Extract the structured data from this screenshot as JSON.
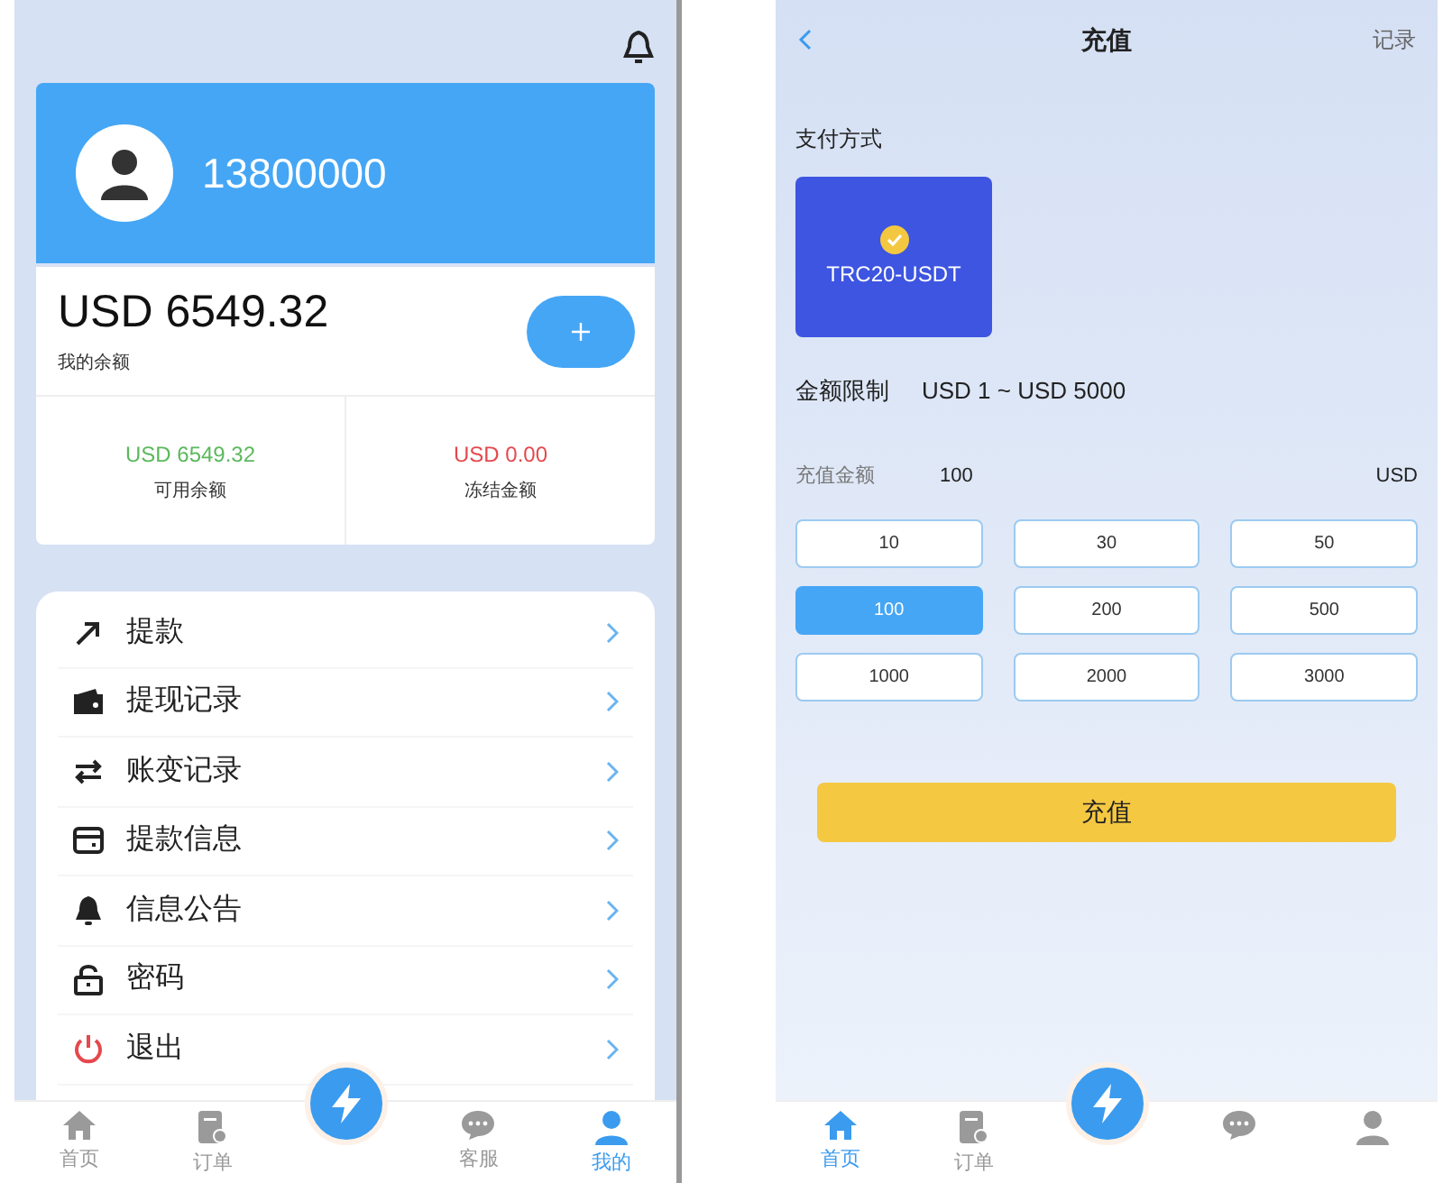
{
  "account_screen": {
    "user": {
      "phone": "13800000"
    },
    "balance": {
      "amount": "USD 6549.32",
      "label": "我的余额"
    },
    "sub_balances": [
      {
        "amount": "USD 6549.32",
        "label": "可用余额",
        "color": "#5cb85c"
      },
      {
        "amount": "USD 0.00",
        "label": "冻结金额",
        "color": "#e5484d"
      }
    ],
    "menu": [
      {
        "label": "提款"
      },
      {
        "label": "提现记录"
      },
      {
        "label": "账变记录"
      },
      {
        "label": "提款信息"
      },
      {
        "label": "信息公告"
      },
      {
        "label": "密码"
      },
      {
        "label": "退出"
      }
    ],
    "tab_bar": [
      {
        "label": "首页",
        "selected": false
      },
      {
        "label": "订单",
        "selected": false
      },
      {
        "label": "客服",
        "selected": false
      },
      {
        "label": "我的",
        "selected": true
      }
    ]
  },
  "recharge_screen": {
    "title": "充值",
    "record_link": "记录",
    "payment_label": "支付方式",
    "payment_methods": [
      {
        "label": "TRC20-USDT",
        "selected": true
      }
    ],
    "limit": {
      "label": "金额限制",
      "value": "USD 1 ~ USD 5000"
    },
    "amount": {
      "label": "充值金额",
      "value": "100",
      "unit": "USD"
    },
    "presets": [
      {
        "label": "10",
        "selected": false
      },
      {
        "label": "30",
        "selected": false
      },
      {
        "label": "50",
        "selected": false
      },
      {
        "label": "100",
        "selected": true
      },
      {
        "label": "200",
        "selected": false
      },
      {
        "label": "500",
        "selected": false
      },
      {
        "label": "1000",
        "selected": false
      },
      {
        "label": "2000",
        "selected": false
      },
      {
        "label": "3000",
        "selected": false
      }
    ],
    "submit": "充值",
    "tab_bar": [
      {
        "label": "首页",
        "selected": true
      },
      {
        "label": "订单",
        "selected": false
      },
      {
        "selected": false
      },
      {
        "selected": false
      }
    ]
  }
}
